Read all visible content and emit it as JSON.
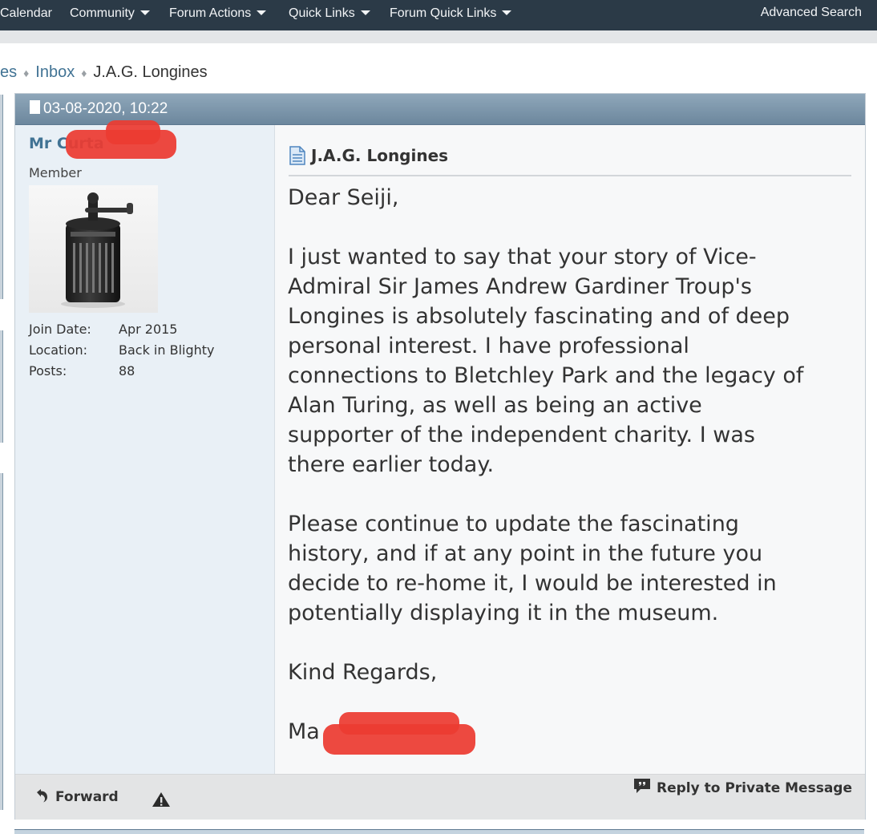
{
  "nav": {
    "items": [
      {
        "label": "Calendar",
        "dropdown": false
      },
      {
        "label": "Community",
        "dropdown": true
      },
      {
        "label": "Forum Actions",
        "dropdown": true
      },
      {
        "label": "Quick Links",
        "dropdown": true
      },
      {
        "label": "Forum Quick Links",
        "dropdown": true
      }
    ],
    "advanced_search": "Advanced Search"
  },
  "breadcrumb": {
    "parent_partial": "es",
    "inbox": "Inbox",
    "current": "J.A.G. Longines"
  },
  "post": {
    "date": "03-08-2020, 10:22",
    "user": {
      "name_visible": "Mr Curta",
      "title": "Member",
      "stats": [
        {
          "label": "Join Date:",
          "value": "Apr 2015"
        },
        {
          "label": "Location:",
          "value": "Back in Blighty"
        },
        {
          "label": "Posts:",
          "value": "88"
        }
      ]
    },
    "message": {
      "title": "J.A.G. Longines",
      "lines": [
        "Dear Seiji,",
        "",
        "I just wanted to say that your story of Vice-",
        "Admiral Sir James Andrew Gardiner Troup's",
        "Longines is absolutely fascinating and of deep",
        "personal interest. I have professional",
        "connections to Bletchley Park and the legacy of",
        "Alan Turing, as well as being an active",
        "supporter of the independent charity. I was",
        "there earlier today.",
        "",
        "Please continue to update the fascinating",
        "history, and if at any point in the future you",
        "decide to re-home it, I would be interested in",
        "potentially displaying it in the museum.",
        "",
        "Kind Regards,",
        "",
        "Ma"
      ]
    },
    "footer": {
      "forward": "Forward",
      "reply": "Reply to Private Message"
    }
  },
  "colors": {
    "nav_bg": "#2b3a47",
    "link": "#417394",
    "post_header": "#7a93a8",
    "redaction": "#ec3b32"
  }
}
